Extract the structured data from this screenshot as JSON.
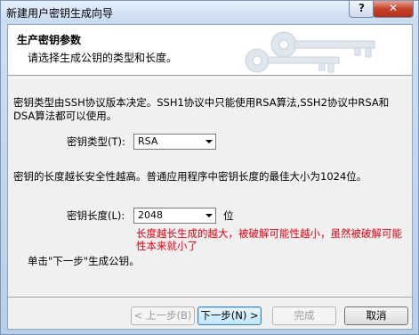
{
  "window": {
    "title": "新建用户密钥生成向导",
    "help_symbol": "?",
    "close_symbol": "✕"
  },
  "header": {
    "title": "生产密钥参数",
    "subtitle": "请选择生成公钥的类型和长度。"
  },
  "content": {
    "desc1_line1": "密钥类型由SSH协议版本决定。SSH1协议中只能使用RSA算法,SSH2协议中RSA和",
    "desc1_line2": "DSA算法都可以使用。",
    "key_type_label": "密钥类型(T):",
    "key_type_value": "RSA",
    "desc2": "密钥的长度越长安全性越高。普通应用程序中密钥长度的最佳大小为1024位。",
    "key_length_label": "密钥长度(L):",
    "key_length_value": "2048",
    "key_length_unit": "位",
    "annotation_line1": "长度越长生成的越大，被破解可能性越小，虽然被破解可能",
    "annotation_line2": "性本来就小了",
    "instruction": "单击\"下一步\"生成公钥。"
  },
  "buttons": {
    "back": "< 上一步(B)",
    "next": "下一步(N) >",
    "finish": "完成",
    "cancel": "取消"
  },
  "colors": {
    "annotation": "#e60012"
  }
}
